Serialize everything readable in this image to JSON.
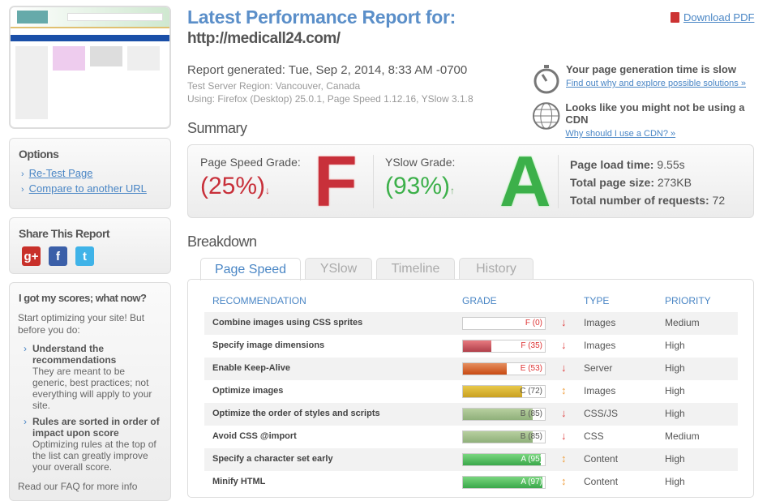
{
  "sidebar": {
    "options": {
      "title": "Options",
      "items": [
        "Re-Test Page",
        "Compare to another URL"
      ]
    },
    "share": {
      "title": "Share This Report",
      "icons": [
        "google-plus-icon",
        "facebook-icon",
        "twitter-icon"
      ]
    },
    "scores": {
      "title": "I got my scores; what now?",
      "intro": "Start optimizing your site! But before you do:",
      "tips": [
        {
          "head": "Understand the recommendations",
          "body": "They are meant to be generic, best practices; not everything will apply to your site."
        },
        {
          "head": "Rules are sorted in order of impact upon score",
          "body": "Optimizing rules at the top of the list can greatly improve your overall score."
        }
      ],
      "footer": "Read our FAQ for more info"
    }
  },
  "header": {
    "title": "Latest Performance Report for:",
    "url": "http://medicall24.com/",
    "download": "Download PDF"
  },
  "report": {
    "generated": "Report generated: Tue, Sep 2, 2014, 8:33 AM -0700",
    "region": "Test Server Region: Vancouver, Canada",
    "using": "Using: Firefox (Desktop) 25.0.1, Page Speed 1.12.16, YSlow 3.1.8"
  },
  "alerts": [
    {
      "title": "Your page generation time is slow",
      "link": "Find out why and explore possible solutions »"
    },
    {
      "title": "Looks like you might not be using a CDN",
      "link": "Why should I use a CDN? »"
    }
  ],
  "summary": {
    "heading": "Summary",
    "pagespeed_label": "Page Speed Grade:",
    "pagespeed_pct": "(25%)",
    "pagespeed_grade": "F",
    "yslow_label": "YSlow Grade:",
    "yslow_pct": "(93%)",
    "yslow_grade": "A",
    "load_label": "Page load time:",
    "load": "9.55s",
    "size_label": "Total page size:",
    "size": "273KB",
    "req_label": "Total number of requests:",
    "req": "72"
  },
  "breakdown": {
    "heading": "Breakdown",
    "tabs": [
      "Page Speed",
      "YSlow",
      "Timeline",
      "History"
    ],
    "columns": [
      "RECOMMENDATION",
      "GRADE",
      "TYPE",
      "PRIORITY"
    ],
    "rows": [
      {
        "rec": "Combine images using CSS sprites",
        "grade": "F (0)",
        "score": 0,
        "trend": "down",
        "type": "Images",
        "priority": "Medium"
      },
      {
        "rec": "Specify image dimensions",
        "grade": "F (35)",
        "score": 35,
        "trend": "down",
        "type": "Images",
        "priority": "High"
      },
      {
        "rec": "Enable Keep-Alive",
        "grade": "E (53)",
        "score": 53,
        "trend": "down",
        "type": "Server",
        "priority": "High"
      },
      {
        "rec": "Optimize images",
        "grade": "C (72)",
        "score": 72,
        "trend": "updown",
        "type": "Images",
        "priority": "High"
      },
      {
        "rec": "Optimize the order of styles and scripts",
        "grade": "B (85)",
        "score": 85,
        "trend": "down",
        "type": "CSS/JS",
        "priority": "High"
      },
      {
        "rec": "Avoid CSS @import",
        "grade": "B (85)",
        "score": 85,
        "trend": "down",
        "type": "CSS",
        "priority": "Medium"
      },
      {
        "rec": "Specify a character set early",
        "grade": "A (95)",
        "score": 95,
        "trend": "updown",
        "type": "Content",
        "priority": "High"
      },
      {
        "rec": "Minify HTML",
        "grade": "A (97)",
        "score": 97,
        "trend": "updown",
        "type": "Content",
        "priority": "High"
      }
    ]
  },
  "colors": {
    "accent": "#4a86c5",
    "grade_f": "#c8303a",
    "grade_a": "#3cb04a"
  }
}
